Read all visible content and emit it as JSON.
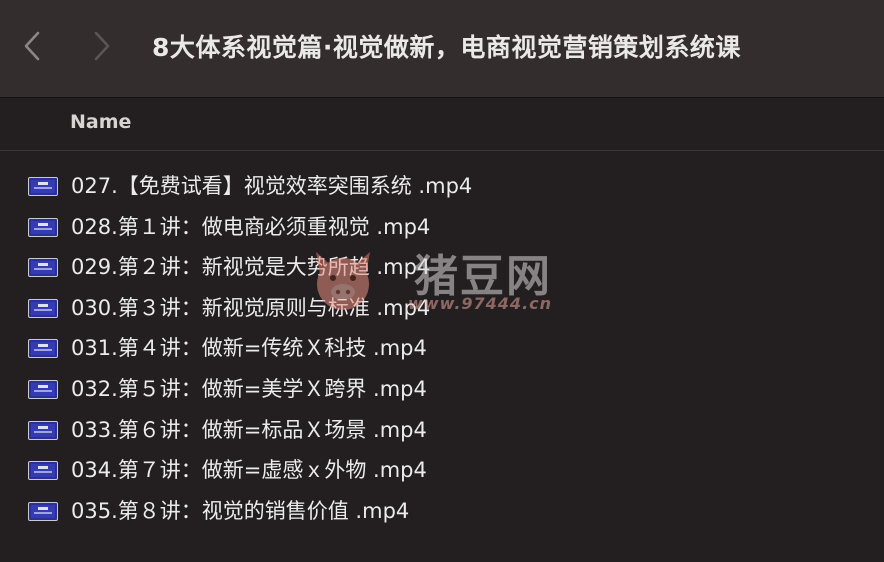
{
  "window": {
    "title": "8大体系视觉篇·视觉做新，电商视觉营销策划系统课"
  },
  "toolbar": {
    "back_icon": "chevron-left-icon",
    "forward_icon": "chevron-right-icon"
  },
  "columns": {
    "name": "Name"
  },
  "files": [
    {
      "name": "027.【免费试看】视觉效率突围系统 .mp4",
      "icon": "video-file-icon"
    },
    {
      "name": "028.第１讲：做电商必须重视觉 .mp4",
      "icon": "video-file-icon"
    },
    {
      "name": "029.第２讲：新视觉是大势所趋 .mp4",
      "icon": "video-file-icon"
    },
    {
      "name": "030.第３讲：新视觉原则与标准 .mp4",
      "icon": "video-file-icon"
    },
    {
      "name": "031.第４讲：做新=传统Ｘ科技 .mp4",
      "icon": "video-file-icon"
    },
    {
      "name": "032.第５讲：做新=美学Ｘ跨界 .mp4",
      "icon": "video-file-icon"
    },
    {
      "name": "033.第６讲：做新=标品Ｘ场景 .mp4",
      "icon": "video-file-icon"
    },
    {
      "name": "034.第７讲：做新=虚感ｘ外物 .mp4",
      "icon": "video-file-icon"
    },
    {
      "name": "035.第８讲：视觉的销售价值 .mp4",
      "icon": "video-file-icon"
    }
  ],
  "watermark": {
    "brand": "猪豆网",
    "url": "www.97444.cn"
  },
  "colors": {
    "background": "#231f20",
    "toolbar": "#332d2e",
    "text": "#ecebeb",
    "icon_blue": "#2a2f9a",
    "watermark_url": "#e4a39a"
  }
}
